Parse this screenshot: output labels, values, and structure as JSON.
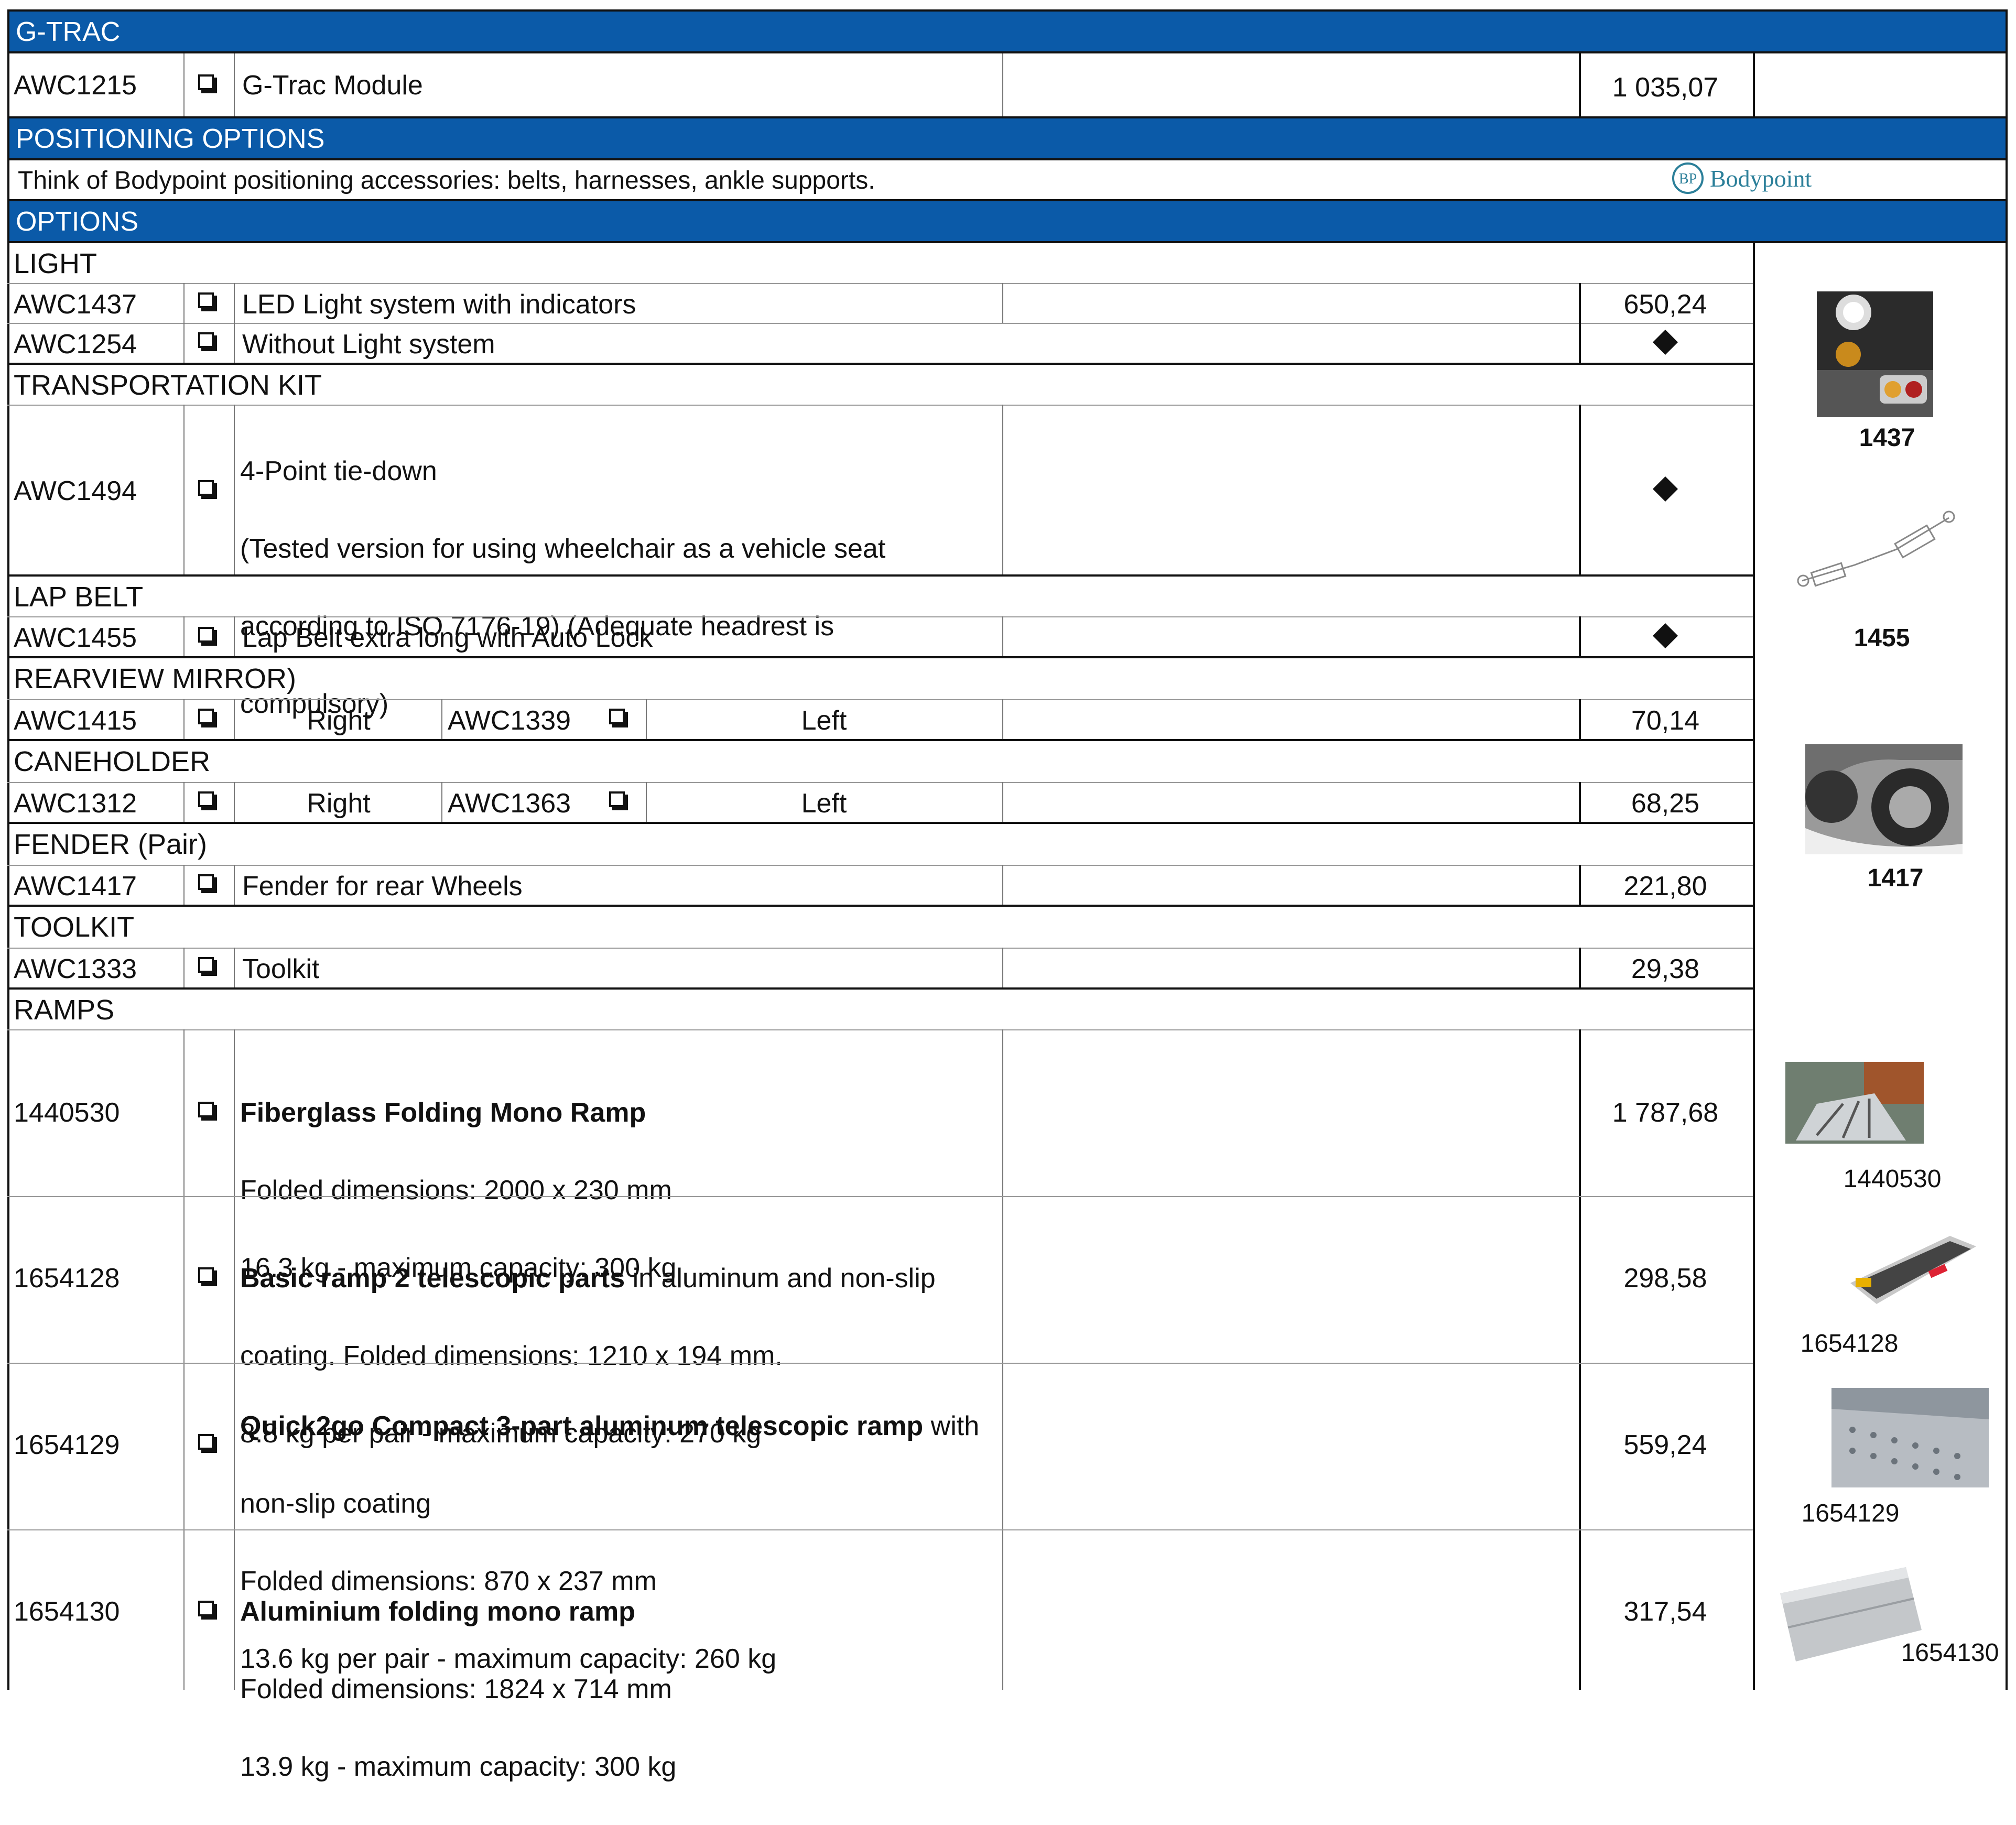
{
  "sections": {
    "gtrac": "G-TRAC",
    "positioning": "POSITIONING OPTIONS",
    "options": "OPTIONS"
  },
  "gtrac_row": {
    "code": "AWC1215",
    "label": "G-Trac Module",
    "price": "1 035,07"
  },
  "positioning_note": "Think of Bodypoint positioning accessories: belts, harnesses, ankle supports.",
  "bodypoint_logo": "Bodypoint",
  "light": {
    "title": "LIGHT",
    "rows": [
      {
        "code": "AWC1437",
        "label": "LED Light system with indicators",
        "price": "650,24"
      },
      {
        "code": "AWC1254",
        "label": "Without Light system",
        "price": ""
      }
    ]
  },
  "transport": {
    "title": "TRANSPORTATION KIT",
    "code": "AWC1494",
    "lines": [
      "4-Point tie-down",
      "(Tested version for using wheelchair as a vehicle seat",
      "according to ISO 7176-19) (Adequate headrest is",
      "compulsory)"
    ]
  },
  "lapbelt": {
    "title": "LAP BELT",
    "code": "AWC1455",
    "label": "Lap Belt extra long with Auto Lock"
  },
  "mirror": {
    "title": "REARVIEW MIRROR)",
    "code_right": "AWC1415",
    "right": "Right",
    "code_left": "AWC1339",
    "left": "Left",
    "price": "70,14"
  },
  "caneholder": {
    "title": "CANEHOLDER",
    "code_right": "AWC1312",
    "right": "Right",
    "code_left": "AWC1363",
    "left": "Left",
    "price": "68,25"
  },
  "fender": {
    "title": "FENDER (Pair)",
    "code": "AWC1417",
    "label": "Fender for rear Wheels",
    "price": "221,80"
  },
  "toolkit": {
    "title": "TOOLKIT",
    "code": "AWC1333",
    "label": "Toolkit",
    "price": "29,38"
  },
  "ramps": {
    "title": "RAMPS",
    "rows": [
      {
        "code": "1440530",
        "bold": "Fiberglass Folding Mono Ramp",
        "rest": "",
        "lines": [
          "Folded dimensions: 2000 x 230 mm",
          "16.3 kg - maximum capacity: 300 kg"
        ],
        "price": "1 787,68"
      },
      {
        "code": "1654128",
        "bold": "Basic ramp 2 telescopic parts",
        "rest": " in aluminum and non-slip",
        "lines": [
          "coating. Folded dimensions: 1210 x 194 mm.",
          "8.8 kg per pair - maximum capacity: 270 kg"
        ],
        "price": "298,58"
      },
      {
        "code": "1654129",
        "bold": "Quick2go Compact 3-part aluminum telescopic ramp",
        "rest": " with",
        "lines": [
          "non-slip coating",
          "Folded dimensions: 870 x 237 mm",
          "13.6 kg per pair - maximum capacity: 260 kg"
        ],
        "price": "559,24"
      },
      {
        "code": "1654130",
        "bold": "Aluminium folding mono ramp",
        "rest": "",
        "lines": [
          "Folded dimensions: 1824 x 714 mm",
          "13.9 kg - maximum capacity: 300 kg"
        ],
        "price": "317,54"
      }
    ]
  },
  "captions": {
    "c1437": "1437",
    "c1455": "1455",
    "c1417": "1417",
    "c1440530": "1440530",
    "c1654128": "1654128",
    "c1654129": "1654129",
    "c1654130": "1654130"
  }
}
